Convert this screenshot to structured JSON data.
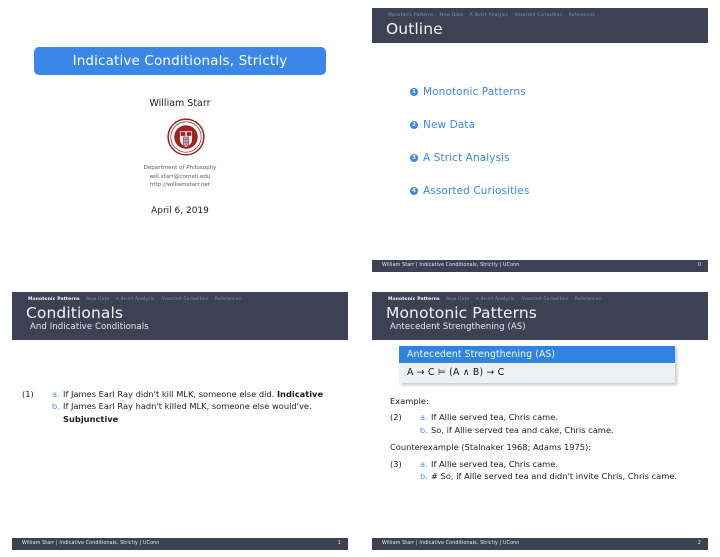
{
  "nav": {
    "items": [
      "Monotonic Patterns",
      "New Data",
      "A Strict Analysis",
      "Assorted Curiosities",
      "References"
    ]
  },
  "footer": {
    "text": "William Starr | Indicative Conditionals, Strictly | UConn"
  },
  "colors": {
    "accent_blue": "#3b87e8",
    "header_slate": "#3c4254",
    "seal_red": "#9b2423",
    "block_title_blue": "#2f84e0",
    "block_body_grey": "#eff0f2"
  },
  "title_slide": {
    "title": "Indicative Conditionals, Strictly",
    "author": "William Starr",
    "logo": "cornell-seal",
    "department": "Department of Philosophy",
    "email": "will.starr@cornell.edu",
    "website": "http://williamstarr.net",
    "date": "April 6, 2019"
  },
  "outline_slide": {
    "frametitle": "Outline",
    "page_number": "0",
    "items": [
      {
        "num": "1",
        "label": "Monotonic Patterns"
      },
      {
        "num": "2",
        "label": "New Data"
      },
      {
        "num": "3",
        "label": "A Strict Analysis"
      },
      {
        "num": "4",
        "label": "Assorted Curiosities"
      }
    ]
  },
  "conditionals_slide": {
    "frametitle": "Conditionals",
    "framesubtitle": "And Indicative Conditionals",
    "page_number": "1",
    "example": {
      "number": "(1)",
      "rows": [
        {
          "letter": "a.",
          "text": "If James Earl Ray didn't kill MLK, someone else did.",
          "bold_tail": "Indicative"
        },
        {
          "letter": "b.",
          "text": "If James Earl Ray hadn't killed MLK, someone else would've.",
          "bold_tail": "Subjunctive"
        }
      ]
    }
  },
  "monotonic_slide": {
    "frametitle": "Monotonic Patterns",
    "framesubtitle": "Antecedent Strengthening (AS)",
    "page_number": "2",
    "block": {
      "title": "Antecedent Strengthening (AS)",
      "formula": "A → C ⊨ (A ∧ B) → C"
    },
    "example_caption": "Example:",
    "example": {
      "number": "(2)",
      "rows": [
        {
          "letter": "a.",
          "text": "If Allie served tea, Chris came."
        },
        {
          "letter": "b.",
          "text": "So, if Allie served tea and cake, Chris came."
        }
      ]
    },
    "counterexample_caption": "Counterexample (Stalnaker 1968; Adams 1975):",
    "counterexample": {
      "number": "(3)",
      "rows": [
        {
          "letter": "a.",
          "text": "If Allie served tea, Chris came."
        },
        {
          "letter": "b.",
          "text": "# So, if Allie served tea and didn't invite Chris, Chris came."
        }
      ]
    }
  }
}
